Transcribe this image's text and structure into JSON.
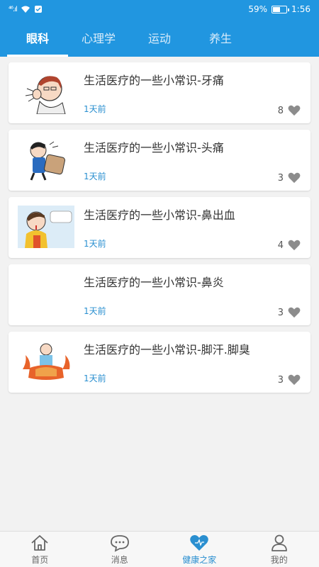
{
  "status": {
    "signal": "⁴⁶.ıl",
    "battery_pct": "59%",
    "battery_level": 0.59,
    "time": "1:56"
  },
  "tabs": [
    {
      "label": "眼科",
      "active": true
    },
    {
      "label": "心理学",
      "active": false
    },
    {
      "label": "运动",
      "active": false
    },
    {
      "label": "养生",
      "active": false
    }
  ],
  "articles": [
    {
      "title": "生活医疗的一些小常识-牙痛",
      "time": "1天前",
      "likes": "8",
      "thumb": "toothache-illustration"
    },
    {
      "title": "生活医疗的一些小常识-头痛",
      "time": "1天前",
      "likes": "3",
      "thumb": "headache-illustration"
    },
    {
      "title": "生活医疗的一些小常识-鼻出血",
      "time": "1天前",
      "likes": "4",
      "thumb": "nosebleed-illustration"
    },
    {
      "title": "生活医疗的一些小常识-鼻炎",
      "time": "1天前",
      "likes": "3",
      "thumb": ""
    },
    {
      "title": "生活医疗的一些小常识-脚汗.脚臭",
      "time": "1天前",
      "likes": "3",
      "thumb": "foot-odor-illustration"
    }
  ],
  "nav": [
    {
      "label": "首页",
      "icon": "home-icon"
    },
    {
      "label": "消息",
      "icon": "message-icon"
    },
    {
      "label": "健康之家",
      "icon": "heart-icon",
      "active": true
    },
    {
      "label": "我的",
      "icon": "person-icon"
    }
  ],
  "colors": {
    "primary": "#2196e0",
    "time_text": "#2a8fd0",
    "heart_gray": "#8c8c8c",
    "nav_active": "#2a8fd0"
  }
}
